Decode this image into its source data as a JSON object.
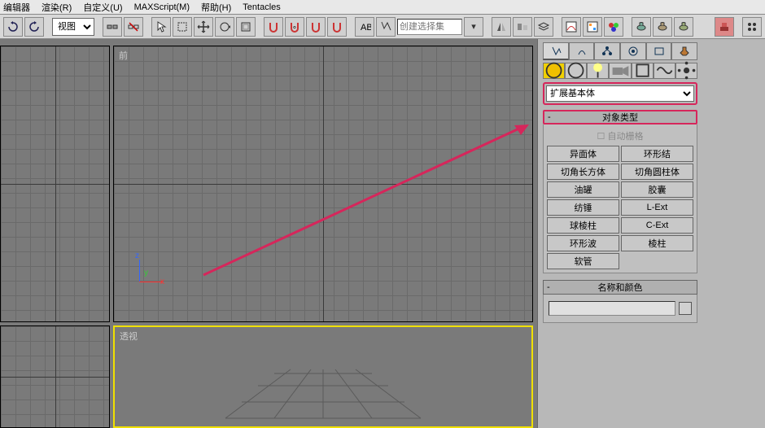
{
  "menu": {
    "editor": "编辑器",
    "render": "渲染(R)",
    "custom": "自定义(U)",
    "maxscript": "MAXScript(M)",
    "help": "帮助(H)",
    "tentacles": "Tentacles"
  },
  "toolbar": {
    "view_dropdown": "视图",
    "selection_set_placeholder": "创建选择集"
  },
  "viewports": {
    "front": "前",
    "perspective": "透视"
  },
  "axis": {
    "x": "x",
    "y": "y",
    "z": "z"
  },
  "panel": {
    "dropdown_value": "扩展基本体",
    "object_type_title": "对象类型",
    "auto_grid": "自动栅格",
    "name_color_title": "名称和颜色",
    "buttons": {
      "r0c0": "异面体",
      "r0c1": "环形结",
      "r1c0": "切角长方体",
      "r1c1": "切角圆柱体",
      "r2c0": "油罐",
      "r2c1": "胶囊",
      "r3c0": "纺锤",
      "r3c1": "L-Ext",
      "r4c0": "球棱柱",
      "r4c1": "C-Ext",
      "r5c0": "环形波",
      "r5c1": "棱柱",
      "r6c0": "软管"
    }
  }
}
